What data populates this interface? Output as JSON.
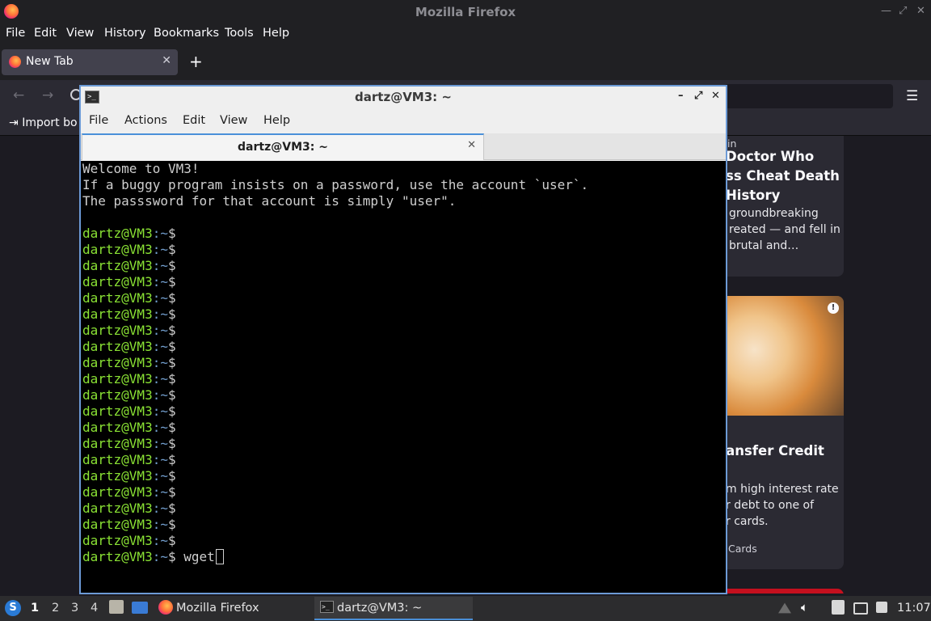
{
  "firefox": {
    "window_title": "Mozilla Firefox",
    "menu": [
      "File",
      "Edit",
      "View",
      "History",
      "Bookmarks",
      "Tools",
      "Help"
    ],
    "tab": {
      "label": "New Tab"
    },
    "import_bookmarks_label": "Import bo",
    "cards": [
      {
        "meta": "in",
        "headline": [
          "Doctor Who",
          "ss Cheat Death",
          "History"
        ],
        "excerpt": [
          "groundbreaking",
          "reated — and fell in",
          "brutal and…"
        ]
      },
      {
        "headline": "ransfer Credit",
        "excerpt": [
          "m high interest rate",
          "r debt to one of",
          "r cards."
        ],
        "source": "Cards"
      }
    ]
  },
  "terminal": {
    "window_title": "dartz@VM3: ~",
    "menu": [
      "File",
      "Actions",
      "Edit",
      "View",
      "Help"
    ],
    "tab_label": "dartz@VM3: ~",
    "motd": [
      "Welcome to VM3!",
      "If a buggy program insists on a password, use the account `user`.",
      "The passsword for that account is simply \"user\"."
    ],
    "prompt_user": "dartz@VM3",
    "prompt_path": ":~",
    "prompt_symbol": "$",
    "empty_prompts": 20,
    "current_command": "wget"
  },
  "taskbar": {
    "workspaces": [
      "1",
      "2",
      "3",
      "4"
    ],
    "tasks": [
      "Mozilla Firefox",
      "dartz@VM3: ~"
    ],
    "clock": "11:07"
  },
  "colors": {
    "prompt_user": "#8ae234",
    "prompt_path": "#729fcf",
    "terminal_bg": "#000000",
    "firefox_bg": "#1c1b22",
    "accent": "#4a90d9"
  }
}
